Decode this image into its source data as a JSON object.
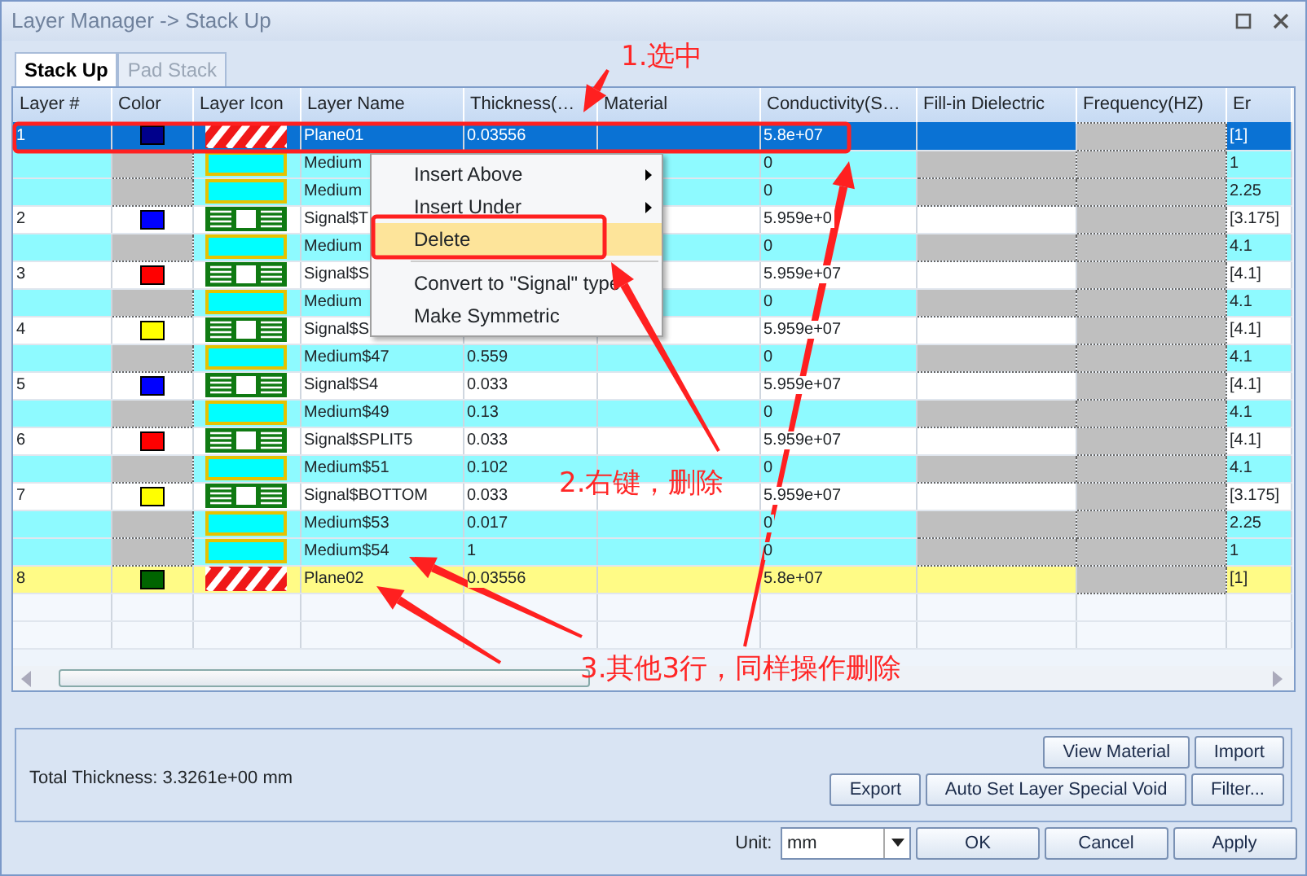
{
  "window": {
    "title": "Layer Manager -> Stack Up"
  },
  "tabs": [
    {
      "label": "Stack Up",
      "selected": true
    },
    {
      "label": "Pad Stack",
      "selected": false
    }
  ],
  "table": {
    "columns": [
      "Layer #",
      "Color",
      "Layer Icon",
      "Layer Name",
      "Thickness(…",
      "Material",
      "Conductivity(S…",
      "Fill-in Dielectric",
      "Frequency(HZ)",
      "Er"
    ],
    "rows": [
      {
        "kind": "plane",
        "layer": "1",
        "color": "#00008b",
        "name": "Plane01",
        "thickness": "0.03556",
        "conductivity": "5.8e+07",
        "er": "[1]",
        "selected": true,
        "highlighted": false
      },
      {
        "kind": "medium",
        "name": "Medium",
        "conductivity": "0",
        "er": "1",
        "selected": false,
        "highlighted": false
      },
      {
        "kind": "medium",
        "name": "Medium",
        "conductivity": "0",
        "er": "2.25",
        "selected": false,
        "highlighted": false
      },
      {
        "kind": "signal",
        "layer": "2",
        "color": "#0000ff",
        "name": "Signal$T",
        "conductivity": "5.959e+0",
        "er": "[3.175]",
        "selected": false,
        "highlighted": false
      },
      {
        "kind": "medium",
        "name": "Medium",
        "conductivity": "0",
        "er": "4.1",
        "selected": false,
        "highlighted": false
      },
      {
        "kind": "signal",
        "layer": "3",
        "color": "#ff0000",
        "name": "Signal$S",
        "conductivity": "5.959e+07",
        "er": "[4.1]",
        "selected": false,
        "highlighted": false
      },
      {
        "kind": "medium",
        "name": "Medium",
        "conductivity": "0",
        "er": "4.1",
        "selected": false,
        "highlighted": false
      },
      {
        "kind": "signal",
        "layer": "4",
        "color": "#ffff00",
        "name": "Signal$S",
        "conductivity": "5.959e+07",
        "er": "[4.1]",
        "selected": false,
        "highlighted": false
      },
      {
        "kind": "medium",
        "name": "Medium$47",
        "thickness": "0.559",
        "conductivity": "0",
        "er": "4.1",
        "selected": false,
        "highlighted": false
      },
      {
        "kind": "signal",
        "layer": "5",
        "color": "#0000ff",
        "name": "Signal$S4",
        "thickness": "0.033",
        "conductivity": "5.959e+07",
        "er": "[4.1]",
        "selected": false,
        "highlighted": false
      },
      {
        "kind": "medium",
        "name": "Medium$49",
        "thickness": "0.13",
        "conductivity": "0",
        "er": "4.1",
        "selected": false,
        "highlighted": false
      },
      {
        "kind": "signal",
        "layer": "6",
        "color": "#ff0000",
        "name": "Signal$SPLIT5",
        "thickness": "0.033",
        "conductivity": "5.959e+07",
        "er": "[4.1]",
        "selected": false,
        "highlighted": false
      },
      {
        "kind": "medium",
        "name": "Medium$51",
        "thickness": "0.102",
        "conductivity": "0",
        "er": "4.1",
        "selected": false,
        "highlighted": false
      },
      {
        "kind": "signal",
        "layer": "7",
        "color": "#ffff00",
        "name": "Signal$BOTTOM",
        "thickness": "0.033",
        "conductivity": "5.959e+07",
        "er": "[3.175]",
        "selected": false,
        "highlighted": false
      },
      {
        "kind": "medium",
        "name": "Medium$53",
        "thickness": "0.017",
        "conductivity": "0",
        "er": "2.25",
        "selected": false,
        "highlighted": false
      },
      {
        "kind": "medium",
        "name": "Medium$54",
        "thickness": "1",
        "conductivity": "0",
        "er": "1",
        "selected": false,
        "highlighted": false
      },
      {
        "kind": "plane",
        "layer": "8",
        "color": "#006400",
        "name": "Plane02",
        "thickness": "0.03556",
        "conductivity": "5.8e+07",
        "er": "[1]",
        "selected": false,
        "highlighted": true
      }
    ]
  },
  "context_menu": {
    "items": [
      {
        "kind": "item",
        "label": "Insert Above",
        "submenu": true,
        "highlighted": false
      },
      {
        "kind": "item",
        "label": "Insert Under",
        "submenu": true,
        "highlighted": false
      },
      {
        "kind": "item",
        "label": "Delete",
        "submenu": false,
        "highlighted": true
      },
      {
        "kind": "separator"
      },
      {
        "kind": "item",
        "label": "Convert to \"Signal\" type",
        "submenu": false,
        "highlighted": false
      },
      {
        "kind": "item",
        "label": "Make Symmetric",
        "submenu": false,
        "highlighted": false
      }
    ]
  },
  "total_thickness": "Total Thickness:  3.3261e+00 mm",
  "panel_buttons": [
    [
      "View Material",
      "Import"
    ],
    [
      "Export",
      "Auto Set Layer Special Void",
      "Filter..."
    ]
  ],
  "unit": {
    "label": "Unit:",
    "value": "mm"
  },
  "dialog_buttons": [
    "OK",
    "Cancel",
    "Apply"
  ],
  "annotations": [
    "1.选中",
    "2.右键，删除",
    "3.其他3行，同样操作删除"
  ]
}
